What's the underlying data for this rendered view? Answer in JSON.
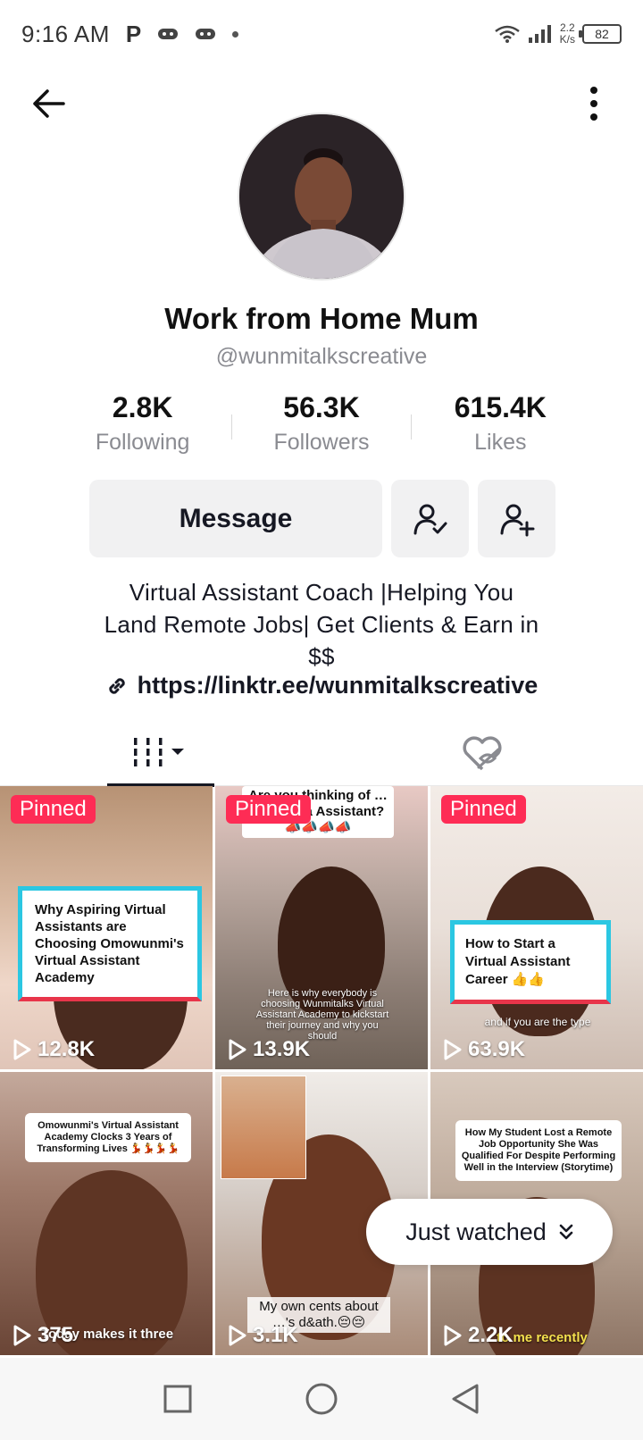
{
  "status_bar": {
    "time": "9:16 AM",
    "speed_value": "2.2",
    "speed_unit": "K/s",
    "battery": "82"
  },
  "profile": {
    "display_name": "Work from Home Mum",
    "handle": "@wunmitalkscreative",
    "stats": [
      {
        "value": "2.8K",
        "label": "Following"
      },
      {
        "value": "56.3K",
        "label": "Followers"
      },
      {
        "value": "615.4K",
        "label": "Likes"
      }
    ],
    "message_label": "Message",
    "bio_line1": "Virtual Assistant Coach |Helping You",
    "bio_line2": "Land Remote Jobs| Get Clients & Earn in",
    "bio_line3": "$$",
    "link": "https://linktr.ee/wunmitalkscreative"
  },
  "videos": [
    {
      "pinned": "Pinned",
      "views": "12.8K",
      "caption": "Why Aspiring Virtual Assistants are Choosing Omowunmi's Virtual Assistant Academy"
    },
    {
      "pinned": "Pinned",
      "views": "13.9K",
      "caption": "Are you thinking of … g a Virtua Assistant? 📣📣📣📣",
      "subcaption": "Here is why everybody is choosing Wunmitalks Virtual Assistant Academy to kickstart their journey and why you should"
    },
    {
      "pinned": "Pinned",
      "views": "63.9K",
      "caption": "How to Start a Virtual Assistant Career 👍👍",
      "subcaption": "and if you are the type"
    },
    {
      "views": "375",
      "caption": "Omowunmi's Virtual Assistant Academy Clocks 3 Years of Transforming Lives 💃💃💃💃",
      "subcaption": "Today makes it three"
    },
    {
      "views": "3.1K",
      "caption": "My own cents about …'s d&ath.😔😔"
    },
    {
      "views": "2.2K",
      "caption": "How My Student Lost a Remote Job Opportunity She Was Qualified For Despite Performing Well in the Interview (Storytime)",
      "subcaption": "to me recently"
    }
  ],
  "just_watched": "Just watched",
  "colors": {
    "pinned": "#fe2c55",
    "button_bg": "#f1f1f2",
    "muted_text": "#8a8b91"
  },
  "icons": {
    "back": "arrow-left-icon",
    "more": "vertical-dots-icon",
    "following_status": "user-check-icon",
    "add_friend": "user-plus-icon",
    "link": "link-icon",
    "videos_tab": "grid-bars-icon",
    "liked_tab": "heart-hidden-icon",
    "play": "play-icon"
  }
}
